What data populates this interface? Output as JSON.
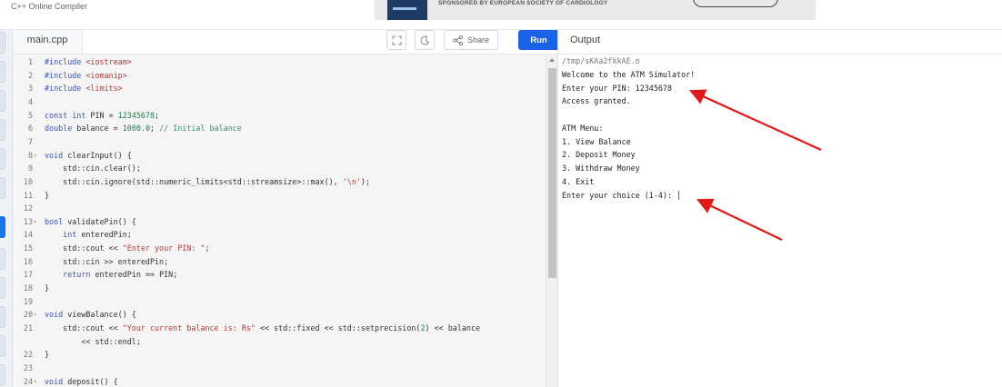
{
  "app_title": "C++ Online Compiler",
  "ad": {
    "text": "SPONSORED BY EUROPEAN SOCIETY OF CARDIOLOGY"
  },
  "tab": {
    "filename": "main.cpp"
  },
  "toolbar": {
    "share_label": "Share",
    "run_label": "Run"
  },
  "output_panel": {
    "title": "Output"
  },
  "colors": {
    "run_button": "#1a62e8",
    "annotation_arrow": "#e01818",
    "active_sidebar": "#1a73e8"
  },
  "code_lines": [
    {
      "n": "1",
      "fold": false,
      "tokens": [
        {
          "t": "#include ",
          "c": "kw"
        },
        {
          "t": "<iostream>",
          "c": "str"
        }
      ]
    },
    {
      "n": "2",
      "fold": false,
      "tokens": [
        {
          "t": "#include ",
          "c": "kw"
        },
        {
          "t": "<iomanip>",
          "c": "str"
        }
      ]
    },
    {
      "n": "3",
      "fold": false,
      "tokens": [
        {
          "t": "#include ",
          "c": "kw"
        },
        {
          "t": "<limits>",
          "c": "str"
        }
      ]
    },
    {
      "n": "4",
      "fold": false,
      "tokens": []
    },
    {
      "n": "5",
      "fold": false,
      "tokens": [
        {
          "t": "const int",
          "c": "kw"
        },
        {
          "t": " PIN = ",
          "c": "fn"
        },
        {
          "t": "12345678",
          "c": "num"
        },
        {
          "t": ";",
          "c": "fn"
        }
      ]
    },
    {
      "n": "6",
      "fold": false,
      "tokens": [
        {
          "t": "double",
          "c": "kw"
        },
        {
          "t": " balance = ",
          "c": "fn"
        },
        {
          "t": "1000.0",
          "c": "num"
        },
        {
          "t": "; ",
          "c": "fn"
        },
        {
          "t": "// Initial balance",
          "c": "cm"
        }
      ]
    },
    {
      "n": "7",
      "fold": false,
      "tokens": []
    },
    {
      "n": "8",
      "fold": true,
      "tokens": [
        {
          "t": "void",
          "c": "kw"
        },
        {
          "t": " clearInput() {",
          "c": "fn"
        }
      ]
    },
    {
      "n": "9",
      "fold": false,
      "tokens": [
        {
          "t": "    std::cin.clear();",
          "c": "fn"
        }
      ]
    },
    {
      "n": "10",
      "fold": false,
      "tokens": [
        {
          "t": "    std::cin.ignore(std::numeric_limits<std::streamsize>::max(), ",
          "c": "fn"
        },
        {
          "t": "'\\n'",
          "c": "str"
        },
        {
          "t": ");",
          "c": "fn"
        }
      ]
    },
    {
      "n": "11",
      "fold": false,
      "tokens": [
        {
          "t": "}",
          "c": "fn"
        }
      ]
    },
    {
      "n": "12",
      "fold": false,
      "tokens": []
    },
    {
      "n": "13",
      "fold": true,
      "tokens": [
        {
          "t": "bool",
          "c": "kw"
        },
        {
          "t": " validatePin() {",
          "c": "fn"
        }
      ]
    },
    {
      "n": "14",
      "fold": false,
      "tokens": [
        {
          "t": "    ",
          "c": "fn"
        },
        {
          "t": "int",
          "c": "kw"
        },
        {
          "t": " enteredPin;",
          "c": "fn"
        }
      ]
    },
    {
      "n": "15",
      "fold": false,
      "tokens": [
        {
          "t": "    std::cout << ",
          "c": "fn"
        },
        {
          "t": "\"Enter your PIN: \"",
          "c": "str"
        },
        {
          "t": ";",
          "c": "fn"
        }
      ]
    },
    {
      "n": "16",
      "fold": false,
      "tokens": [
        {
          "t": "    std::cin >> enteredPin;",
          "c": "fn"
        }
      ]
    },
    {
      "n": "17",
      "fold": false,
      "tokens": [
        {
          "t": "    ",
          "c": "fn"
        },
        {
          "t": "return",
          "c": "kw"
        },
        {
          "t": " enteredPin == PIN;",
          "c": "fn"
        }
      ]
    },
    {
      "n": "18",
      "fold": false,
      "tokens": [
        {
          "t": "}",
          "c": "fn"
        }
      ]
    },
    {
      "n": "19",
      "fold": false,
      "tokens": []
    },
    {
      "n": "20",
      "fold": true,
      "tokens": [
        {
          "t": "void",
          "c": "kw"
        },
        {
          "t": " viewBalance() {",
          "c": "fn"
        }
      ]
    },
    {
      "n": "21",
      "fold": false,
      "tokens": [
        {
          "t": "    std::cout << ",
          "c": "fn"
        },
        {
          "t": "\"Your current balance is: Rs\"",
          "c": "str"
        },
        {
          "t": " << std::fixed << std::setprecision(",
          "c": "fn"
        },
        {
          "t": "2",
          "c": "num"
        },
        {
          "t": ") << balance",
          "c": "fn"
        }
      ]
    },
    {
      "n": "",
      "fold": false,
      "tokens": [
        {
          "t": "        << std::endl;",
          "c": "fn"
        }
      ]
    },
    {
      "n": "22",
      "fold": false,
      "tokens": [
        {
          "t": "}",
          "c": "fn"
        }
      ]
    },
    {
      "n": "23",
      "fold": false,
      "tokens": []
    },
    {
      "n": "24",
      "fold": true,
      "tokens": [
        {
          "t": "void",
          "c": "kw"
        },
        {
          "t": " deposit() {",
          "c": "fn"
        }
      ]
    }
  ],
  "output_lines": [
    {
      "text": "/tmp/sKAa2fkkAE.o",
      "color": "#777777"
    },
    {
      "text": "Welcome to the ATM Simulator!",
      "color": "#222222"
    },
    {
      "text": "Enter your PIN: 12345678",
      "color": "#222222"
    },
    {
      "text": "Access granted.",
      "color": "#222222"
    },
    {
      "text": "",
      "color": "#222222"
    },
    {
      "text": "ATM Menu:",
      "color": "#222222"
    },
    {
      "text": "1. View Balance",
      "color": "#222222"
    },
    {
      "text": "2. Deposit Money",
      "color": "#222222"
    },
    {
      "text": "3. Withdraw Money",
      "color": "#222222"
    },
    {
      "text": "4. Exit",
      "color": "#222222"
    },
    {
      "text": "Enter your choice (1-4): ",
      "color": "#222222",
      "cursor": true
    }
  ]
}
